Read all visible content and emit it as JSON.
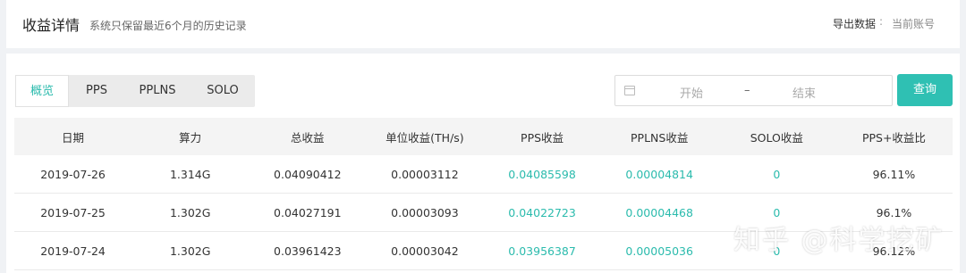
{
  "header": {
    "title": "收益详情",
    "subtitle": "系统只保留最近6个月的历史记录",
    "export_label": "导出数据",
    "export_separator": ":",
    "export_account": "当前账号"
  },
  "tabs": [
    "概览",
    "PPS",
    "PPLNS",
    "SOLO"
  ],
  "active_tab": "概览",
  "date_range": {
    "start_placeholder": "开始",
    "separator": "–",
    "end_placeholder": "结束"
  },
  "query_button": "查询",
  "table": {
    "columns": [
      "日期",
      "算力",
      "总收益",
      "单位收益(TH/s)",
      "PPS收益",
      "PPLNS收益",
      "SOLO收益",
      "PPS+收益比"
    ],
    "rows": [
      [
        "2019-07-26",
        "1.314G",
        "0.04090412",
        "0.00003112",
        "0.04085598",
        "0.00004814",
        "0",
        "96.11%"
      ],
      [
        "2019-07-25",
        "1.302G",
        "0.04027191",
        "0.00003093",
        "0.04022723",
        "0.00004468",
        "0",
        "96.1%"
      ],
      [
        "2019-07-24",
        "1.302G",
        "0.03961423",
        "0.00003042",
        "0.03956387",
        "0.00005036",
        "0",
        "96.12%"
      ]
    ]
  },
  "watermark": "知乎 @科学挖矿",
  "colors": {
    "accent": "#2fc0b3",
    "link": "#2bbbad"
  }
}
